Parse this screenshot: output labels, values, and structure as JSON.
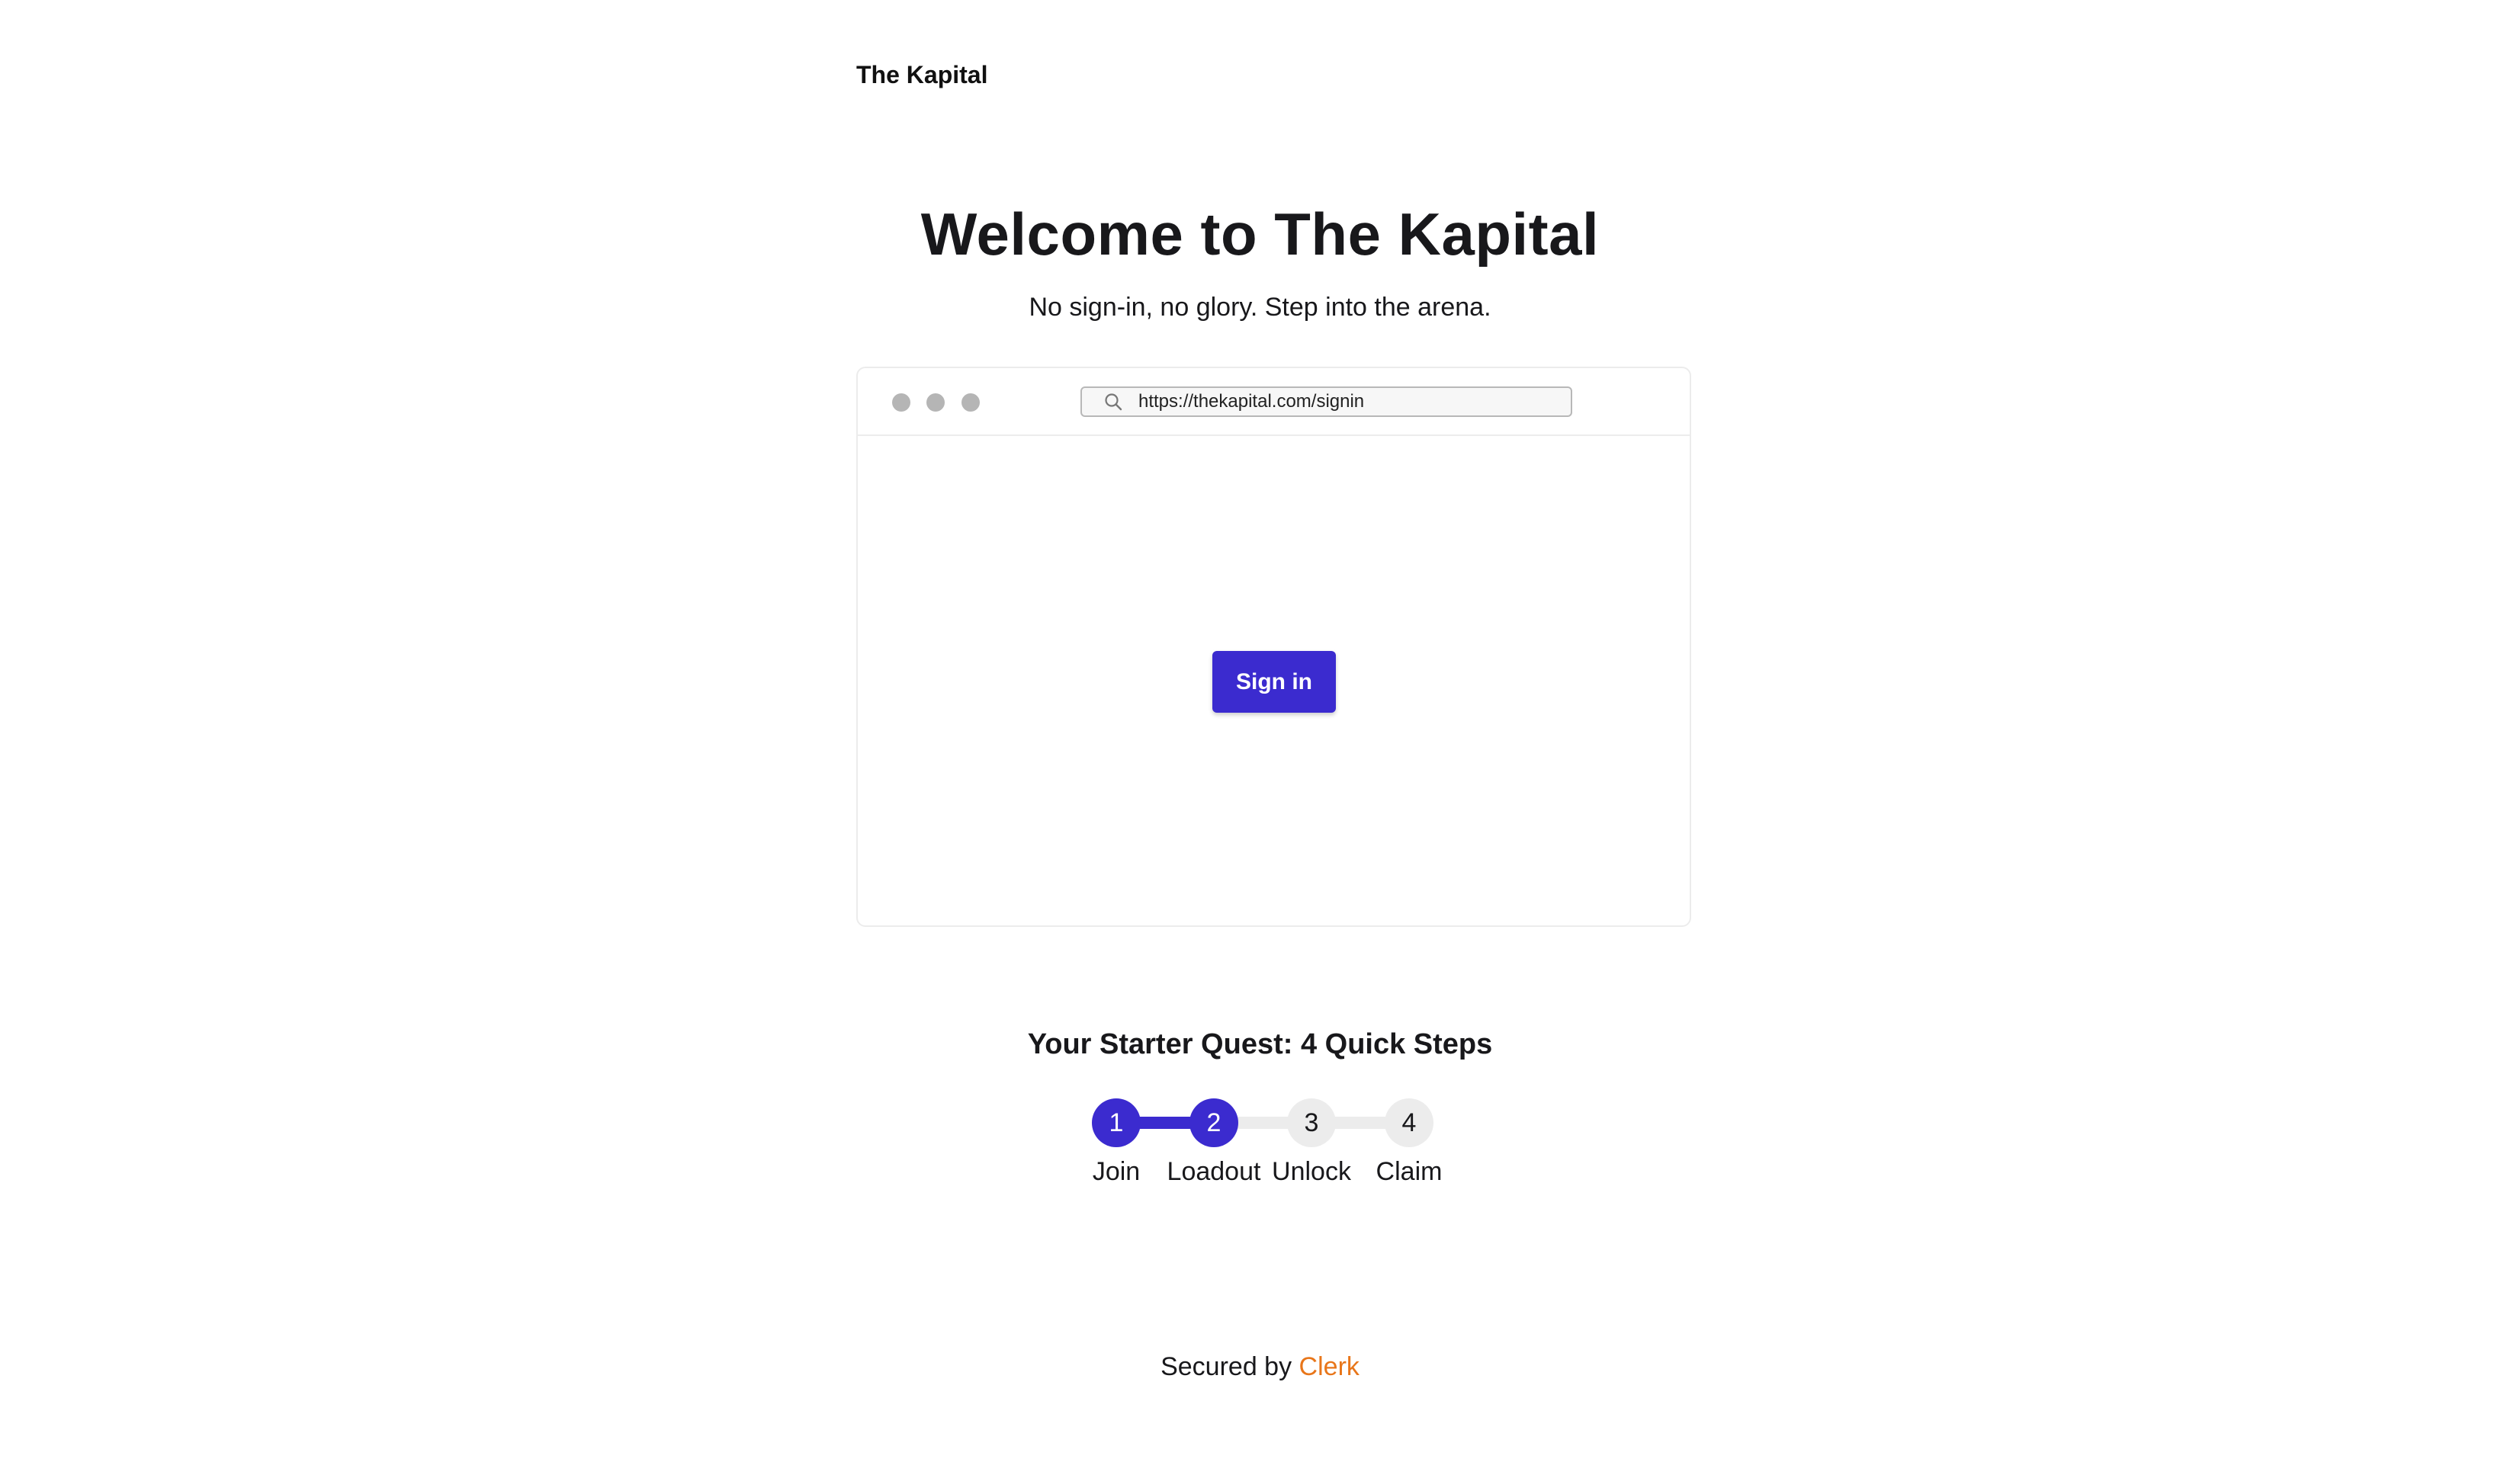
{
  "header": {
    "brand": "The Kapital"
  },
  "hero": {
    "title": "Welcome to The Kapital",
    "subtitle": "No sign-in, no glory. Step into the arena."
  },
  "browser": {
    "url": "https://thekapital.com/signin",
    "sign_in_label": "Sign in",
    "accent_color": "#3b2bcf"
  },
  "quest": {
    "title": "Your Starter Quest: 4 Quick Steps",
    "current_step": 2,
    "steps": [
      {
        "number": "1",
        "label": "Join",
        "completed": true
      },
      {
        "number": "2",
        "label": "Loadout",
        "completed": true
      },
      {
        "number": "3",
        "label": "Unlock",
        "completed": false
      },
      {
        "number": "4",
        "label": "Claim",
        "completed": false
      }
    ]
  },
  "footer": {
    "prefix": "Secured by",
    "link_label": "Clerk",
    "link_color": "#e8761a"
  }
}
